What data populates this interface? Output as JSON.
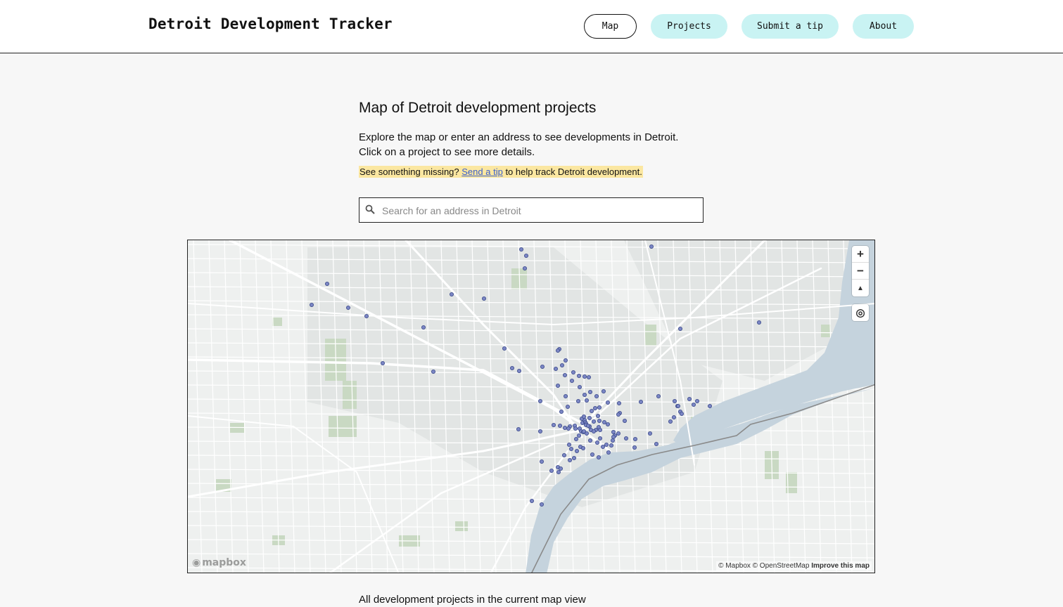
{
  "header": {
    "title": "Detroit Development Tracker",
    "nav": [
      {
        "label": "Map",
        "active": true
      },
      {
        "label": "Projects",
        "active": false
      },
      {
        "label": "Submit a tip",
        "active": false
      },
      {
        "label": "About",
        "active": false
      }
    ]
  },
  "main": {
    "heading": "Map of Detroit development projects",
    "intro_line1": "Explore the map or enter an address to see developments in Detroit.",
    "intro_line2": "Click on a project to see more details.",
    "tip_prefix": "See something missing?",
    "tip_link": "Send a tip",
    "tip_suffix": "to help track Detroit development.",
    "search_placeholder": "Search for an address in Detroit",
    "list_heading": "All development projects in the current map view"
  },
  "map": {
    "controls": {
      "zoom_in": "+",
      "zoom_out": "−",
      "reset_north": "▲",
      "locate": "◎"
    },
    "logo": "mapbox",
    "attribution": "© Mapbox © OpenStreetMap",
    "improve_link": "Improve this map",
    "marker_color": "#7b86c4",
    "water_color": "#c5d3dd",
    "park_color": "#c9d9c3"
  }
}
